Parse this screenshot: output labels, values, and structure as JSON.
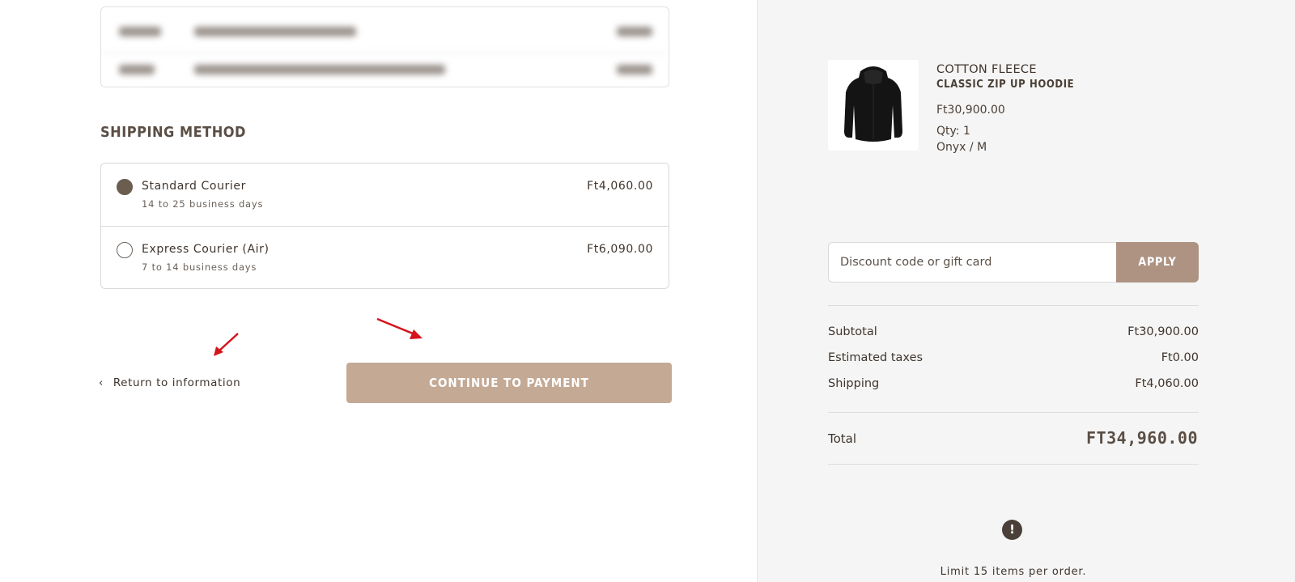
{
  "shipping": {
    "title": "SHIPPING METHOD",
    "methods": [
      {
        "name": "Standard Courier",
        "description": "14 to 25 business days",
        "price": "Ft4,060.00",
        "selected": true
      },
      {
        "name": "Express Courier (Air)",
        "description": "7 to 14 business days",
        "price": "Ft6,090.00",
        "selected": false
      }
    ]
  },
  "actions": {
    "back_label": "Return to information",
    "back_icon": "chevron-left-icon",
    "continue_label": "CONTINUE TO PAYMENT"
  },
  "summary": {
    "product": {
      "brand": "COTTON FLEECE",
      "name": "CLASSIC ZIP UP HOODIE",
      "price": "Ft30,900.00",
      "quantity": "Qty: 1",
      "variant": "Onyx / M"
    },
    "discount": {
      "placeholder": "Discount code or gift card",
      "apply_label": "APPLY"
    },
    "lines": {
      "subtotal_label": "Subtotal",
      "subtotal_value": "Ft30,900.00",
      "taxes_label": "Estimated taxes",
      "taxes_value": "Ft0.00",
      "shipping_label": "Shipping",
      "shipping_value": "Ft4,060.00"
    },
    "total_label": "Total",
    "total_value": "FT34,960.00",
    "notice_icon": "exclamation-icon",
    "notice_text": "Limit 15 items per order."
  },
  "colors": {
    "accent": "#c4a995",
    "apply": "#ae9383",
    "annotation_arrow": "#d6141c",
    "sidebar_bg": "#f5f5f5"
  }
}
